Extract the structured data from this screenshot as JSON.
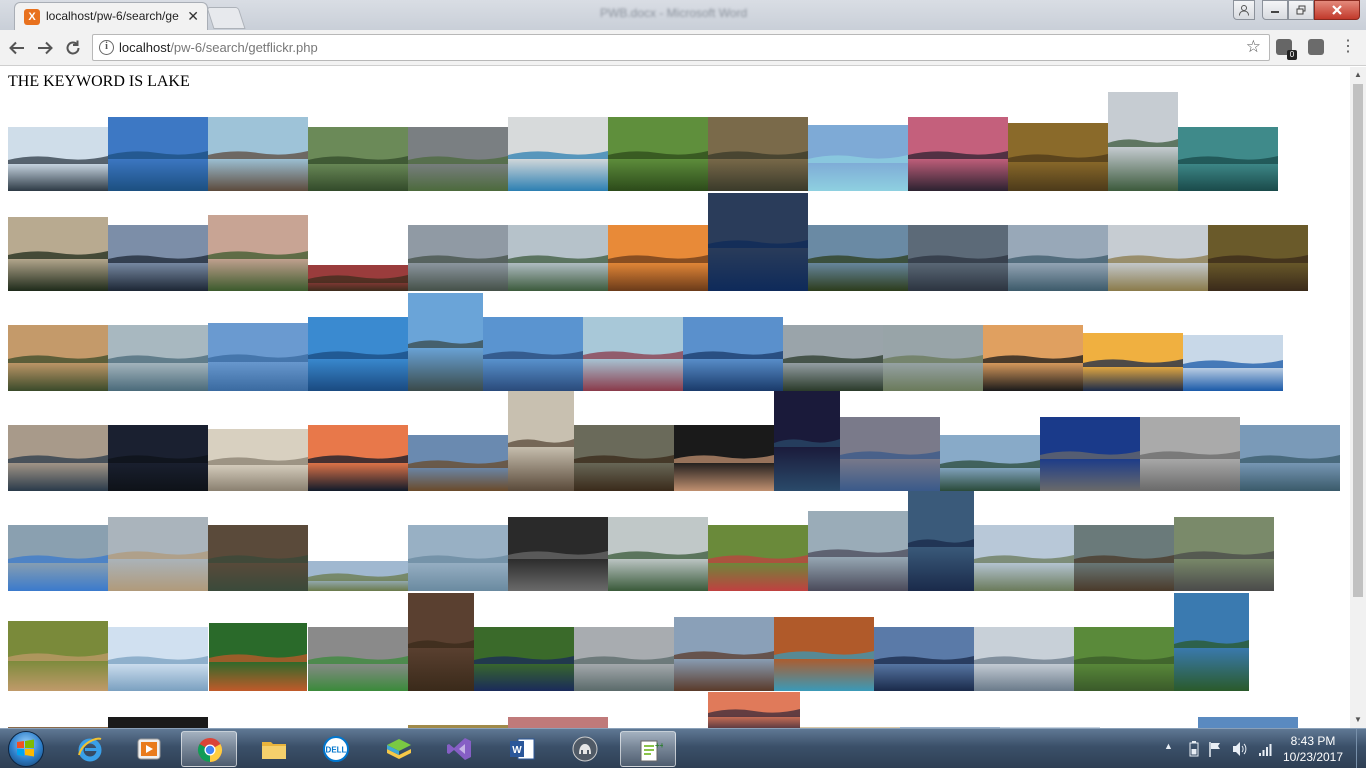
{
  "window": {
    "blurred_title": "PWB.docx - Microsoft Word"
  },
  "tab": {
    "title": "localhost/pw-6/search/ge",
    "favicon_letter": "X",
    "close_glyph": "✕"
  },
  "address_bar": {
    "host": "localhost",
    "path": "/pw-6/search/getflickr.php"
  },
  "extension_badge": "0",
  "page": {
    "heading": "THE KEYWORD IS LAKE"
  },
  "taskbar": {
    "clock_time": "8:43 PM",
    "clock_date": "10/23/2017",
    "apps": [
      "internet-explorer",
      "media-player",
      "chrome",
      "file-explorer",
      "dell",
      "bluestacks",
      "visual-studio",
      "word",
      "app-circle",
      "notepad-plus-plus"
    ]
  },
  "colors": {
    "chrome_tab_active": "#f2f2f2",
    "taskbar": "#3b5069",
    "win_close": "#c1392b",
    "xampp_orange": "#e8711e"
  },
  "gallery_count": 96
}
